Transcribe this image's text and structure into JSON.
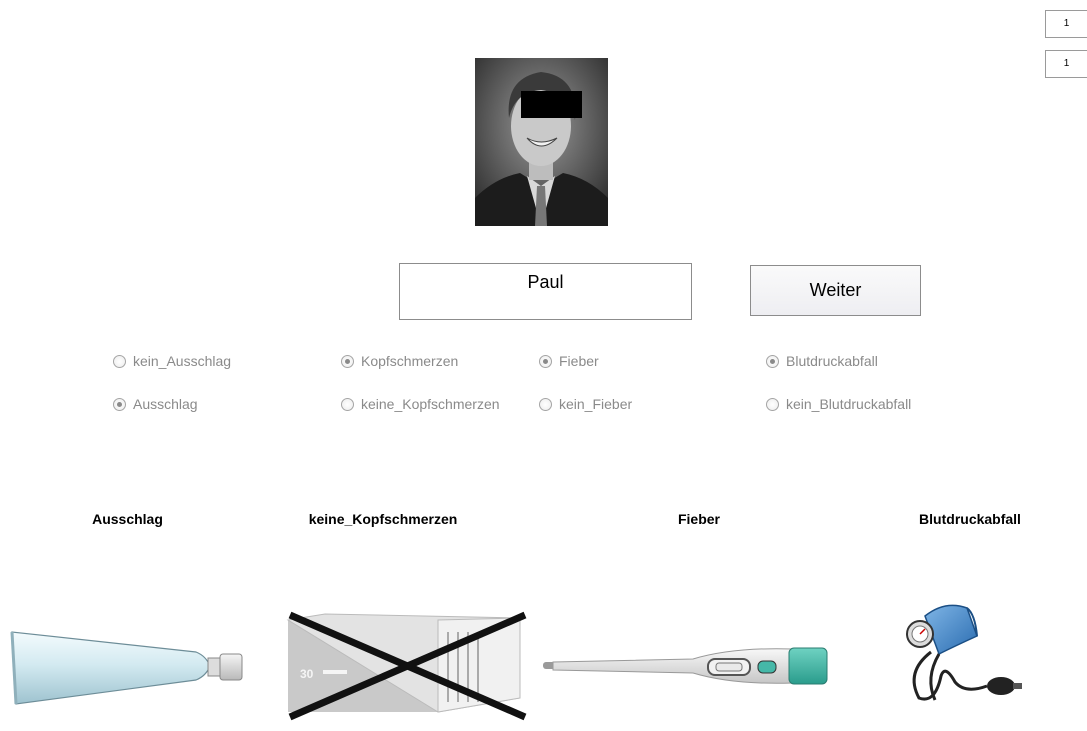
{
  "counters": [
    "1",
    "1"
  ],
  "name_display": "Paul",
  "continue_button": "Weiter",
  "radio_groups": [
    {
      "options": [
        {
          "label": "kein_Ausschlag",
          "selected": false
        },
        {
          "label": "Ausschlag",
          "selected": true
        }
      ]
    },
    {
      "options": [
        {
          "label": "Kopfschmerzen",
          "selected": true
        },
        {
          "label": "keine_Kopfschmerzen",
          "selected": false
        }
      ]
    },
    {
      "options": [
        {
          "label": "Fieber",
          "selected": true
        },
        {
          "label": "kein_Fieber",
          "selected": false
        }
      ]
    },
    {
      "options": [
        {
          "label": "Blutdruckabfall",
          "selected": true
        },
        {
          "label": "kein_Blutdruckabfall",
          "selected": false
        }
      ]
    }
  ],
  "symptom_cards": [
    {
      "caption": "Ausschlag",
      "icon": "ointment-tube-icon"
    },
    {
      "caption": "keine_Kopfschmerzen",
      "icon": "crossed-out-pill-box-icon",
      "box_text": "30"
    },
    {
      "caption": "Fieber",
      "icon": "thermometer-icon"
    },
    {
      "caption": "Blutdruckabfall",
      "icon": "blood-pressure-cuff-icon"
    }
  ]
}
